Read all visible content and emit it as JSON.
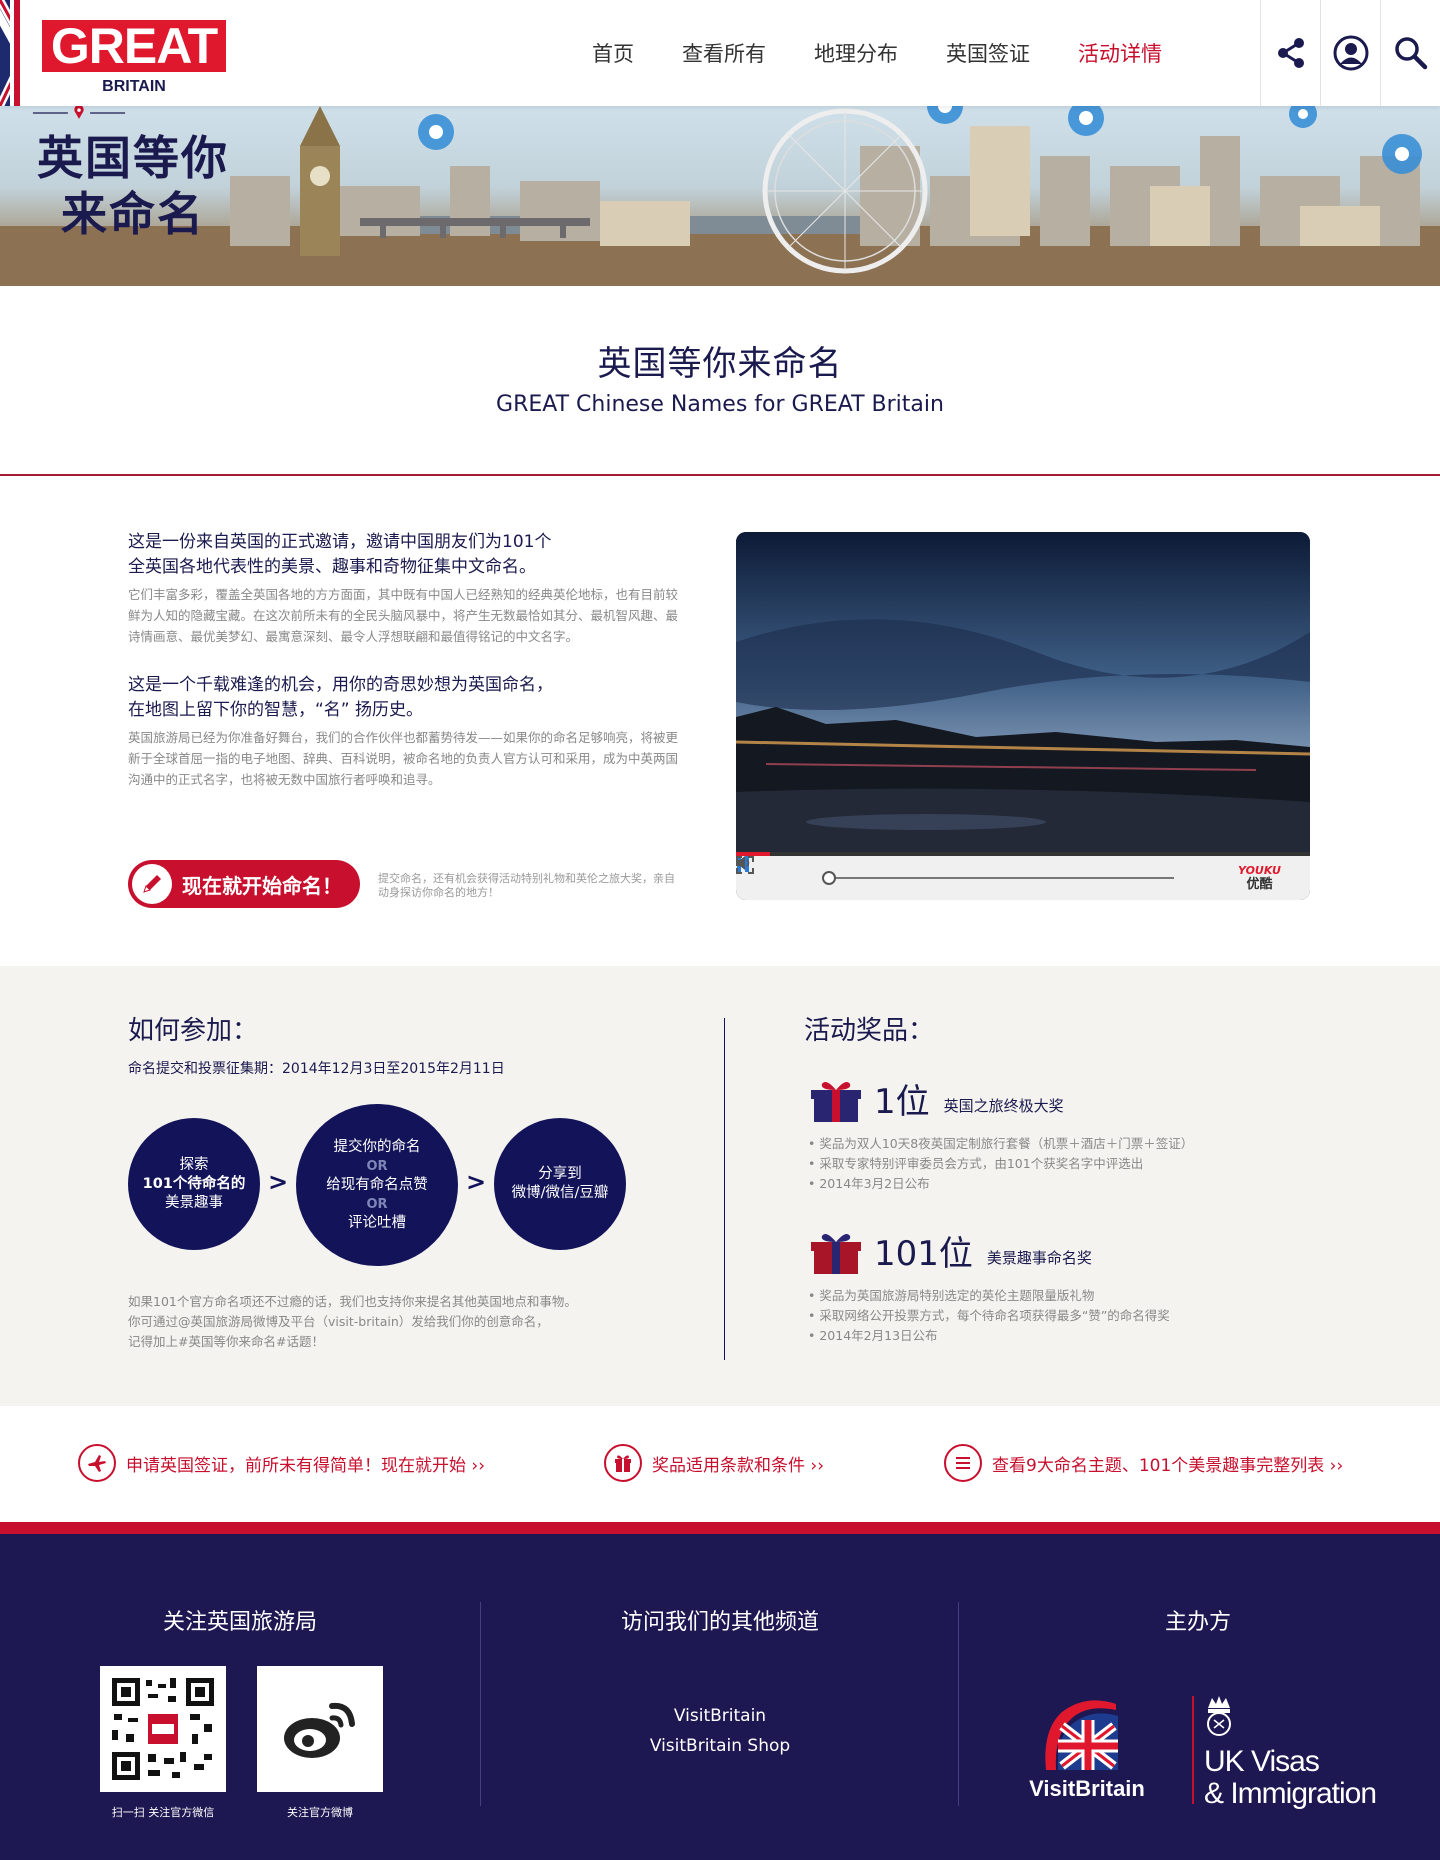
{
  "header": {
    "logo_main": "GREAT",
    "logo_sub": "BRITAIN",
    "nav": [
      "首页",
      "查看所有",
      "地理分布",
      "英国签证",
      "活动详情"
    ],
    "active_nav": "活动详情",
    "icons": [
      "share-icon",
      "user-icon",
      "search-icon"
    ]
  },
  "banner": {
    "title_line1": "英国等你",
    "title_line2": "来命名"
  },
  "intro": {
    "title_cn": "英国等你来命名",
    "title_en": "GREAT Chinese Names for GREAT Britain"
  },
  "description": {
    "heading1_line1": "这是一份来自英国的正式邀请，邀请中国朋友们为101个",
    "heading1_line2": "全英国各地代表性的美景、趣事和奇物征集中文命名。",
    "body1": "它们丰富多彩，覆盖全英国各地的方方面面，其中既有中国人已经熟知的经典英伦地标，也有目前较鲜为人知的隐藏宝藏。在这次前所未有的全民头脑风暴中，将产生无数最恰如其分、最机智风趣、最诗情画意、最优美梦幻、最寓意深刻、最令人浮想联翩和最值得铭记的中文名字。",
    "heading2_line1": "这是一个千载难逢的机会，用你的奇思妙想为英国命名，",
    "heading2_line2": "在地图上留下你的智慧，“名” 扬历史。",
    "body2": "英国旅游局已经为你准备好舞台，我们的合作伙伴也都蓄势待发——如果你的命名足够响亮，将被更新于全球首屈一指的电子地图、辞典、百科说明，被命名地的负责人官方认可和采用，成为中英两国沟通中的正式名字，也将被无数中国旅行者呼唤和追寻。",
    "cta_label": "现在就开始命名！",
    "cta_note": "提交命名，还有机会获得活动特别礼物和英伦之旅大奖，亲自动身探访你命名的地方！"
  },
  "video": {
    "player_brand_en": "YOUKU",
    "player_brand_cn": "优酷",
    "progress": 0.06
  },
  "how": {
    "title": "如何参加：",
    "period": "命名提交和投票征集期：2014年12月3日至2015年2月11日",
    "step1_line1": "探索",
    "step1_line2": "101个待命名的",
    "step1_line3": "美景趣事",
    "step2_line1": "提交你的命名",
    "step2_or": "OR",
    "step2_line2": "给现有命名点赞",
    "step2_line3": "评论吐槽",
    "step3_line1": "分享到",
    "step3_line2": "微博/微信/豆瓣",
    "note_line1": "如果101个官方命名项还不过瘾的话，我们也支持你来提名其他英国地点和事物。",
    "note_line2": "你可通过@英国旅游局微博及平台（visit-britain）发给我们你的创意命名，",
    "note_line3": "记得加上#英国等你来命名#话题！"
  },
  "prizes": {
    "title": "活动奖品：",
    "prize1_rank": "1位",
    "prize1_name": "英国之旅终极大奖",
    "prize1_items": [
      "• 奖品为双人10天8夜英国定制旅行套餐（机票＋酒店＋门票＋签证）",
      "• 采取专家特别评审委员会方式，由101个获奖名字中评选出",
      "• 2014年3月2日公布"
    ],
    "prize2_rank": "101位",
    "prize2_name": "美景趣事命名奖",
    "prize2_items": [
      "• 奖品为英国旅游局特别选定的英伦主题限量版礼物",
      "• 采取网络公开投票方式，每个待命名项获得最多“赞”的命名得奖",
      "• 2014年2月13日公布"
    ]
  },
  "links": {
    "visa": "申请英国签证，前所未有得简单！现在就开始 ››",
    "terms": "奖品适用条款和条件 ››",
    "list": "查看9大命名主题、101个美景趣事完整列表 ››"
  },
  "footer": {
    "follow_title": "关注英国旅游局",
    "wechat_caption": "扫一扫 关注官方微信",
    "weibo_caption": "关注官方微博",
    "channels_title": "访问我们的其他频道",
    "channel1": "VisitBritain",
    "channel2": "VisitBritain Shop",
    "organizer_title": "主办方",
    "organizer1": "VisitBritain",
    "organizer2_line1": "UK Visas",
    "organizer2_line2": "& Immigration"
  },
  "colors": {
    "brand_red": "#c8102e",
    "navy": "#1b1a4e",
    "footer_bg": "#1d1752",
    "step_bg": "#13135a"
  }
}
